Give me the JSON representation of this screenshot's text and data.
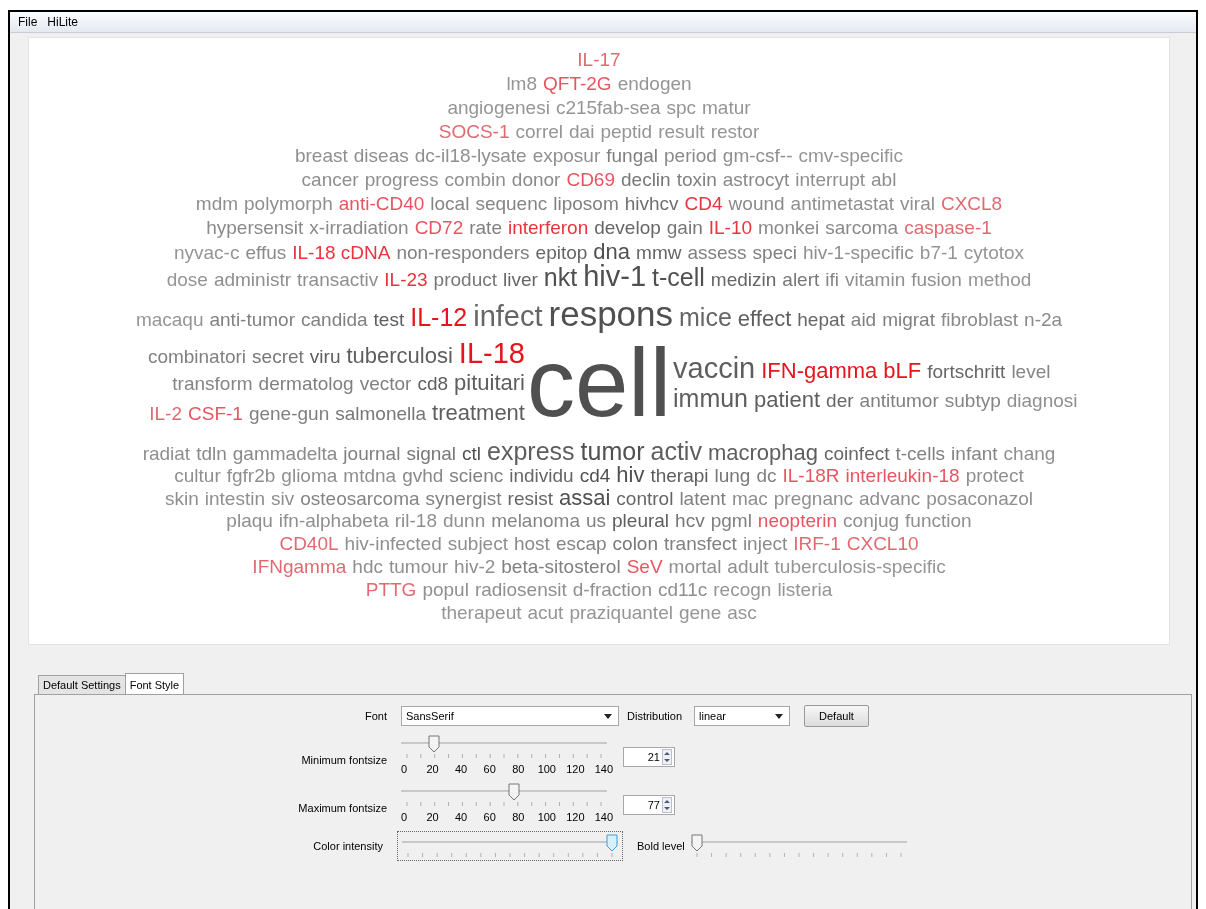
{
  "menu": [
    "File",
    "HiLite"
  ],
  "cloud": {
    "rows_top": [
      [
        {
          "text": "IL-17",
          "color": "#e06a70",
          "kind": "s"
        }
      ],
      [
        {
          "text": "lm8",
          "color": "#959595",
          "kind": "s"
        },
        {
          "text": "QFT-2G",
          "color": "#e85560",
          "kind": "s"
        },
        {
          "text": "endogen",
          "color": "#959595",
          "kind": "s"
        }
      ],
      [
        {
          "text": "angiogenesi",
          "color": "#959595",
          "kind": "s"
        },
        {
          "text": "c215fab-sea",
          "color": "#959595",
          "kind": "s"
        },
        {
          "text": "spc",
          "color": "#959595",
          "kind": "s"
        },
        {
          "text": "matur",
          "color": "#959595",
          "kind": "s"
        }
      ],
      [
        {
          "text": "SOCS-1",
          "color": "#e06a70",
          "kind": "s"
        },
        {
          "text": "correl",
          "color": "#959595",
          "kind": "s"
        },
        {
          "text": "dai",
          "color": "#959595",
          "kind": "s"
        },
        {
          "text": "peptid",
          "color": "#959595",
          "kind": "s"
        },
        {
          "text": "result",
          "color": "#959595",
          "kind": "s"
        },
        {
          "text": "restor",
          "color": "#959595",
          "kind": "s"
        }
      ],
      [
        {
          "text": "breast",
          "color": "#8f8f8f",
          "kind": "s"
        },
        {
          "text": "diseas",
          "color": "#8f8f8f",
          "kind": "s"
        },
        {
          "text": "dc-il18-lysate",
          "color": "#8f8f8f",
          "kind": "s"
        },
        {
          "text": "exposur",
          "color": "#8f8f8f",
          "kind": "s"
        },
        {
          "text": "fungal",
          "color": "#808080",
          "kind": "s"
        },
        {
          "text": "period",
          "color": "#8a8a8a",
          "kind": "s"
        },
        {
          "text": "gm-csf--",
          "color": "#8f8f8f",
          "kind": "s"
        },
        {
          "text": "cmv-specific",
          "color": "#959595",
          "kind": "s"
        }
      ],
      [
        {
          "text": "cancer",
          "color": "#8f8f8f",
          "kind": "s"
        },
        {
          "text": "progress",
          "color": "#8f8f8f",
          "kind": "s"
        },
        {
          "text": "combin",
          "color": "#8f8f8f",
          "kind": "s"
        },
        {
          "text": "donor",
          "color": "#8a8a8a",
          "kind": "s"
        },
        {
          "text": "CD69",
          "color": "#e85560",
          "kind": "s"
        },
        {
          "text": "declin",
          "color": "#777777",
          "kind": "s"
        },
        {
          "text": "toxin",
          "color": "#808080",
          "kind": "s"
        },
        {
          "text": "astrocyt",
          "color": "#8a8a8a",
          "kind": "s"
        },
        {
          "text": "interrupt",
          "color": "#8f8f8f",
          "kind": "s"
        },
        {
          "text": "abl",
          "color": "#8f8f8f",
          "kind": "s"
        }
      ],
      [
        {
          "text": "mdm",
          "color": "#8f8f8f",
          "kind": "s"
        },
        {
          "text": "polymorph",
          "color": "#8f8f8f",
          "kind": "s"
        },
        {
          "text": "anti-CD40",
          "color": "#e85560",
          "kind": "s"
        },
        {
          "text": "local",
          "color": "#858585",
          "kind": "s"
        },
        {
          "text": "sequenc",
          "color": "#858585",
          "kind": "s"
        },
        {
          "text": "liposom",
          "color": "#808080",
          "kind": "s"
        },
        {
          "text": "hivhcv",
          "color": "#707070",
          "kind": "s"
        },
        {
          "text": "CD4",
          "color": "#e8343c",
          "kind": "s"
        },
        {
          "text": "wound",
          "color": "#8a8a8a",
          "kind": "s"
        },
        {
          "text": "antimetastat",
          "color": "#8f8f8f",
          "kind": "s"
        },
        {
          "text": "viral",
          "color": "#8f8f8f",
          "kind": "s"
        },
        {
          "text": "CXCL8",
          "color": "#e06a70",
          "kind": "s"
        }
      ],
      [
        {
          "text": "hypersensit",
          "color": "#8a8a8a",
          "kind": "s"
        },
        {
          "text": "x-irradiation",
          "color": "#8a8a8a",
          "kind": "s"
        },
        {
          "text": "CD72",
          "color": "#e85560",
          "kind": "s"
        },
        {
          "text": "rate",
          "color": "#808080",
          "kind": "s"
        },
        {
          "text": "interferon",
          "color": "#e8343c",
          "kind": "s"
        },
        {
          "text": "develop",
          "color": "#666666",
          "kind": "s"
        },
        {
          "text": "gain",
          "color": "#777777",
          "kind": "s"
        },
        {
          "text": "IL-10",
          "color": "#e8343c",
          "kind": "s"
        },
        {
          "text": "monkei",
          "color": "#8a8a8a",
          "kind": "s"
        },
        {
          "text": "sarcoma",
          "color": "#8a8a8a",
          "kind": "s"
        },
        {
          "text": "caspase-1",
          "color": "#e06a70",
          "kind": "s"
        }
      ],
      [
        {
          "text": "nyvac-c",
          "color": "#959595",
          "kind": "s"
        },
        {
          "text": "effus",
          "color": "#8a8a8a",
          "kind": "s"
        },
        {
          "text": "IL-18 cDNA",
          "color": "#e8343c",
          "kind": "s"
        },
        {
          "text": "non-responders",
          "color": "#808080",
          "kind": "s"
        },
        {
          "text": "epitop",
          "color": "#666666",
          "kind": "s"
        },
        {
          "text": "dna",
          "color": "#505050",
          "kind": "m"
        },
        {
          "text": "mmw",
          "color": "#666666",
          "kind": "s"
        },
        {
          "text": "assess",
          "color": "#808080",
          "kind": "s"
        },
        {
          "text": "speci",
          "color": "#808080",
          "kind": "s"
        },
        {
          "text": "hiv-1-specific",
          "color": "#8f8f8f",
          "kind": "s"
        },
        {
          "text": "b7-1",
          "color": "#959595",
          "kind": "s"
        },
        {
          "text": "cytotox",
          "color": "#959595",
          "kind": "s"
        }
      ],
      [
        {
          "text": "dose",
          "color": "#959595",
          "kind": "s"
        },
        {
          "text": "administr",
          "color": "#8f8f8f",
          "kind": "s"
        },
        {
          "text": "transactiv",
          "color": "#8f8f8f",
          "kind": "s"
        },
        {
          "text": "IL-23",
          "color": "#e8343c",
          "kind": "s"
        },
        {
          "text": "product",
          "color": "#777777",
          "kind": "s"
        },
        {
          "text": "liver",
          "color": "#666666",
          "kind": "s"
        },
        {
          "text": "nkt",
          "color": "#505050",
          "kind": "l"
        },
        {
          "text": "hiv-1",
          "color": "#505050",
          "kind": "xl"
        },
        {
          "text": "t-cell",
          "color": "#505050",
          "kind": "l"
        },
        {
          "text": "medizin",
          "color": "#666666",
          "kind": "s"
        },
        {
          "text": "alert",
          "color": "#777777",
          "kind": "s"
        },
        {
          "text": "ifi",
          "color": "#858585",
          "kind": "s"
        },
        {
          "text": "vitamin",
          "color": "#8f8f8f",
          "kind": "s"
        },
        {
          "text": "fusion",
          "color": "#8f8f8f",
          "kind": "s"
        },
        {
          "text": "method",
          "color": "#959595",
          "kind": "s"
        }
      ],
      [
        {
          "text": "macaqu",
          "color": "#959595",
          "kind": "s"
        },
        {
          "text": "anti-tumor",
          "color": "#808080",
          "kind": "s"
        },
        {
          "text": "candida",
          "color": "#808080",
          "kind": "s"
        },
        {
          "text": "test",
          "color": "#5e5e5e",
          "kind": "s"
        },
        {
          "text": "IL-12",
          "color": "#e8141c",
          "kind": "l"
        },
        {
          "text": "infect",
          "color": "#666666",
          "kind": "xl"
        },
        {
          "text": "respons",
          "color": "#505050",
          "kind": "xxl"
        },
        {
          "text": "mice",
          "color": "#666666",
          "kind": "l"
        },
        {
          "text": "effect",
          "color": "#5e5e5e",
          "kind": "m"
        },
        {
          "text": "hepat",
          "color": "#666666",
          "kind": "s"
        },
        {
          "text": "aid",
          "color": "#808080",
          "kind": "s"
        },
        {
          "text": "migrat",
          "color": "#808080",
          "kind": "s"
        },
        {
          "text": "fibroblast",
          "color": "#8a8a8a",
          "kind": "s"
        },
        {
          "text": "n-2a",
          "color": "#8a8a8a",
          "kind": "s"
        }
      ]
    ],
    "middle_left": [
      [
        {
          "text": "combinatori",
          "color": "#808080",
          "kind": "s"
        },
        {
          "text": "secret",
          "color": "#777777",
          "kind": "s"
        },
        {
          "text": "viru",
          "color": "#5e5e5e",
          "kind": "s"
        },
        {
          "text": "tuberculosi",
          "color": "#5e5e5e",
          "kind": "m"
        },
        {
          "text": "IL-18",
          "color": "#e8141c",
          "kind": "xl"
        }
      ],
      [
        {
          "text": "transform",
          "color": "#858585",
          "kind": "s"
        },
        {
          "text": "dermatolog",
          "color": "#808080",
          "kind": "s"
        },
        {
          "text": "vector",
          "color": "#808080",
          "kind": "s"
        },
        {
          "text": "cd8",
          "color": "#5e5e5e",
          "kind": "s"
        },
        {
          "text": "pituitari",
          "color": "#5e5e5e",
          "kind": "m"
        }
      ],
      [
        {
          "text": "IL-2",
          "color": "#e06a70",
          "kind": "s"
        },
        {
          "text": "CSF-1",
          "color": "#e85560",
          "kind": "s"
        },
        {
          "text": "gene-gun",
          "color": "#808080",
          "kind": "s"
        },
        {
          "text": "salmonella",
          "color": "#777777",
          "kind": "s"
        },
        {
          "text": "treatment",
          "color": "#5e5e5e",
          "kind": "m"
        }
      ]
    ],
    "middle_center": {
      "text": "cell",
      "color": "#505050",
      "kind": "giant"
    },
    "middle_right": [
      [
        {
          "text": "vaccin",
          "color": "#5e5e5e",
          "kind": "xl"
        },
        {
          "text": "IFN-gamma",
          "color": "#e8141c",
          "kind": "m"
        },
        {
          "text": "bLF",
          "color": "#e8141c",
          "kind": "m"
        },
        {
          "text": "fortschritt",
          "color": "#666666",
          "kind": "s"
        },
        {
          "text": "level",
          "color": "#858585",
          "kind": "s"
        }
      ],
      [
        {
          "text": "immun",
          "color": "#5e5e5e",
          "kind": "l"
        },
        {
          "text": "patient",
          "color": "#5e5e5e",
          "kind": "m"
        },
        {
          "text": "der",
          "color": "#666666",
          "kind": "s"
        },
        {
          "text": "antitumor",
          "color": "#808080",
          "kind": "s"
        },
        {
          "text": "subtyp",
          "color": "#858585",
          "kind": "s"
        },
        {
          "text": "diagnosi",
          "color": "#8f8f8f",
          "kind": "s"
        }
      ]
    ],
    "rows_bottom": [
      [
        {
          "text": "radiat",
          "color": "#8f8f8f",
          "kind": "s"
        },
        {
          "text": "tdln",
          "color": "#8a8a8a",
          "kind": "s"
        },
        {
          "text": "gammadelta",
          "color": "#8a8a8a",
          "kind": "s"
        },
        {
          "text": "journal",
          "color": "#808080",
          "kind": "s"
        },
        {
          "text": "signal",
          "color": "#777777",
          "kind": "s"
        },
        {
          "text": "ctl",
          "color": "#505050",
          "kind": "s"
        },
        {
          "text": "express",
          "color": "#5e5e5e",
          "kind": "l"
        },
        {
          "text": "tumor",
          "color": "#505050",
          "kind": "l"
        },
        {
          "text": "activ",
          "color": "#5e5e5e",
          "kind": "l"
        },
        {
          "text": "macrophag",
          "color": "#5e5e5e",
          "kind": "m"
        },
        {
          "text": "coinfect",
          "color": "#666666",
          "kind": "s"
        },
        {
          "text": "t-cells",
          "color": "#808080",
          "kind": "s"
        },
        {
          "text": "infant",
          "color": "#858585",
          "kind": "s"
        },
        {
          "text": "chang",
          "color": "#8f8f8f",
          "kind": "s"
        }
      ],
      [
        {
          "text": "cultur",
          "color": "#8f8f8f",
          "kind": "s"
        },
        {
          "text": "fgfr2b",
          "color": "#8f8f8f",
          "kind": "s"
        },
        {
          "text": "glioma",
          "color": "#8f8f8f",
          "kind": "s"
        },
        {
          "text": "mtdna",
          "color": "#8f8f8f",
          "kind": "s"
        },
        {
          "text": "gvhd",
          "color": "#8a8a8a",
          "kind": "s"
        },
        {
          "text": "scienc",
          "color": "#808080",
          "kind": "s"
        },
        {
          "text": "individu",
          "color": "#666666",
          "kind": "s"
        },
        {
          "text": "cd4",
          "color": "#505050",
          "kind": "s"
        },
        {
          "text": "hiv",
          "color": "#505050",
          "kind": "m"
        },
        {
          "text": "therapi",
          "color": "#5e5e5e",
          "kind": "s"
        },
        {
          "text": "lung",
          "color": "#777777",
          "kind": "s"
        },
        {
          "text": "dc",
          "color": "#808080",
          "kind": "s"
        },
        {
          "text": "IL-18R",
          "color": "#e85560",
          "kind": "s"
        },
        {
          "text": "interleukin-18",
          "color": "#e85560",
          "kind": "s"
        },
        {
          "text": "protect",
          "color": "#8f8f8f",
          "kind": "s"
        }
      ],
      [
        {
          "text": "skin",
          "color": "#8f8f8f",
          "kind": "s"
        },
        {
          "text": "intestin",
          "color": "#8f8f8f",
          "kind": "s"
        },
        {
          "text": "siv",
          "color": "#8f8f8f",
          "kind": "s"
        },
        {
          "text": "osteosarcoma",
          "color": "#858585",
          "kind": "s"
        },
        {
          "text": "synergist",
          "color": "#808080",
          "kind": "s"
        },
        {
          "text": "resist",
          "color": "#666666",
          "kind": "s"
        },
        {
          "text": "assai",
          "color": "#505050",
          "kind": "m"
        },
        {
          "text": "control",
          "color": "#666666",
          "kind": "s"
        },
        {
          "text": "latent",
          "color": "#808080",
          "kind": "s"
        },
        {
          "text": "mac",
          "color": "#8f8f8f",
          "kind": "s"
        },
        {
          "text": "pregnanc",
          "color": "#8f8f8f",
          "kind": "s"
        },
        {
          "text": "advanc",
          "color": "#8f8f8f",
          "kind": "s"
        },
        {
          "text": "posaconazol",
          "color": "#8f8f8f",
          "kind": "s"
        }
      ],
      [
        {
          "text": "plaqu",
          "color": "#8f8f8f",
          "kind": "s"
        },
        {
          "text": "ifn-alphabeta",
          "color": "#8f8f8f",
          "kind": "s"
        },
        {
          "text": "ril-18",
          "color": "#8f8f8f",
          "kind": "s"
        },
        {
          "text": "dunn",
          "color": "#8f8f8f",
          "kind": "s"
        },
        {
          "text": "melanoma",
          "color": "#858585",
          "kind": "s"
        },
        {
          "text": "us",
          "color": "#808080",
          "kind": "s"
        },
        {
          "text": "pleural",
          "color": "#5e5e5e",
          "kind": "s"
        },
        {
          "text": "hcv",
          "color": "#777777",
          "kind": "s"
        },
        {
          "text": "pgml",
          "color": "#808080",
          "kind": "s"
        },
        {
          "text": "neopterin",
          "color": "#e85560",
          "kind": "s"
        },
        {
          "text": "conjug",
          "color": "#8f8f8f",
          "kind": "s"
        },
        {
          "text": "function",
          "color": "#8f8f8f",
          "kind": "s"
        }
      ],
      [
        {
          "text": "CD40L",
          "color": "#e06a70",
          "kind": "s"
        },
        {
          "text": "hiv-infected",
          "color": "#8f8f8f",
          "kind": "s"
        },
        {
          "text": "subject",
          "color": "#8f8f8f",
          "kind": "s"
        },
        {
          "text": "host",
          "color": "#8a8a8a",
          "kind": "s"
        },
        {
          "text": "escap",
          "color": "#858585",
          "kind": "s"
        },
        {
          "text": "colon",
          "color": "#777777",
          "kind": "s"
        },
        {
          "text": "transfect",
          "color": "#808080",
          "kind": "s"
        },
        {
          "text": "inject",
          "color": "#8a8a8a",
          "kind": "s"
        },
        {
          "text": "IRF-1",
          "color": "#e06a70",
          "kind": "s"
        },
        {
          "text": "CXCL10",
          "color": "#e06a70",
          "kind": "s"
        }
      ],
      [
        {
          "text": "IFNgamma",
          "color": "#e06a70",
          "kind": "s"
        },
        {
          "text": "hdc",
          "color": "#8f8f8f",
          "kind": "s"
        },
        {
          "text": "tumour",
          "color": "#8f8f8f",
          "kind": "s"
        },
        {
          "text": "hiv-2",
          "color": "#8f8f8f",
          "kind": "s"
        },
        {
          "text": "beta-sitosterol",
          "color": "#808080",
          "kind": "s"
        },
        {
          "text": "SeV",
          "color": "#e85560",
          "kind": "s"
        },
        {
          "text": "mortal",
          "color": "#8f8f8f",
          "kind": "s"
        },
        {
          "text": "adult",
          "color": "#8f8f8f",
          "kind": "s"
        },
        {
          "text": "tuberculosis-specific",
          "color": "#959595",
          "kind": "s"
        }
      ],
      [
        {
          "text": "PTTG",
          "color": "#e06a70",
          "kind": "s"
        },
        {
          "text": "popul",
          "color": "#8f8f8f",
          "kind": "s"
        },
        {
          "text": "radiosensit",
          "color": "#8f8f8f",
          "kind": "s"
        },
        {
          "text": "d-fraction",
          "color": "#8f8f8f",
          "kind": "s"
        },
        {
          "text": "cd11c",
          "color": "#8f8f8f",
          "kind": "s"
        },
        {
          "text": "recogn",
          "color": "#959595",
          "kind": "s"
        },
        {
          "text": "listeria",
          "color": "#959595",
          "kind": "s"
        }
      ],
      [
        {
          "text": "therapeut",
          "color": "#959595",
          "kind": "s"
        },
        {
          "text": "acut",
          "color": "#959595",
          "kind": "s"
        },
        {
          "text": "praziquantel",
          "color": "#959595",
          "kind": "s"
        },
        {
          "text": "gene",
          "color": "#959595",
          "kind": "s"
        },
        {
          "text": "asc",
          "color": "#959595",
          "kind": "s"
        }
      ]
    ]
  },
  "tabs": [
    {
      "label": "Default Settings",
      "selected": false
    },
    {
      "label": "Font Style",
      "selected": true
    }
  ],
  "settings": {
    "font_label": "Font",
    "font_value": "SansSerif",
    "distribution_label": "Distribution",
    "distribution_value": "linear",
    "default_button": "Default",
    "min_fontsize": {
      "label": "Minimum fontsize",
      "level": 0.14,
      "tick_labels": [
        "0",
        "20",
        "40",
        "60",
        "80",
        "100",
        "120",
        "140"
      ],
      "value": "21"
    },
    "max_fontsize": {
      "label": "Maximum fontsize",
      "level": 0.55,
      "tick_labels": [
        "0",
        "20",
        "40",
        "60",
        "80",
        "100",
        "120",
        "140"
      ],
      "value": "77"
    },
    "color_intensity": {
      "label": "Color intensity",
      "level": 1.0
    },
    "bold_level": {
      "label": "Bold level",
      "level": 0.0
    }
  }
}
